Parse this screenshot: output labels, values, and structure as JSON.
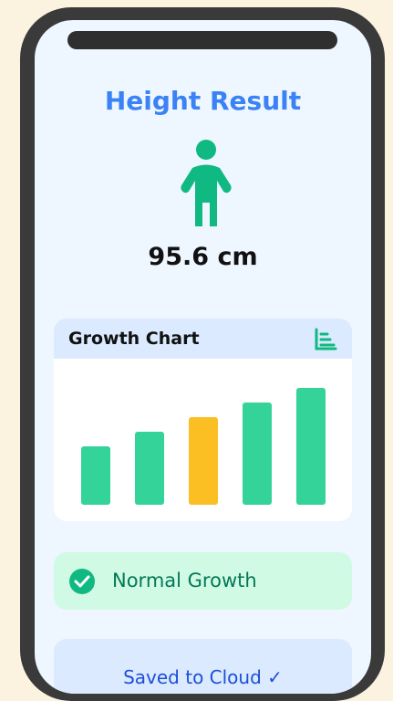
{
  "screen": {
    "title": "Height Result",
    "height_value": "95.6 cm",
    "person_icon": "child-icon"
  },
  "chart": {
    "title": "Growth Chart",
    "icon": "bar-chart-icon"
  },
  "chart_data": {
    "type": "bar",
    "categories": [
      "",
      "",
      "",
      "",
      ""
    ],
    "values": [
      40,
      50,
      60,
      70,
      80
    ],
    "highlight_index": 2,
    "colors": {
      "default": "#34d399",
      "highlight": "#fbbf24"
    },
    "xlabel": "",
    "ylabel": "",
    "ylim": [
      0,
      100
    ]
  },
  "status": {
    "label": "Normal Growth",
    "icon": "check-circle-icon",
    "color": "#047857"
  },
  "save": {
    "label": "Saved to Cloud ✓"
  },
  "colors": {
    "accent": "#3b82f6",
    "success": "#10b981",
    "page_bg": "#fbf2e0",
    "phone_frame": "#3a3a3a"
  }
}
